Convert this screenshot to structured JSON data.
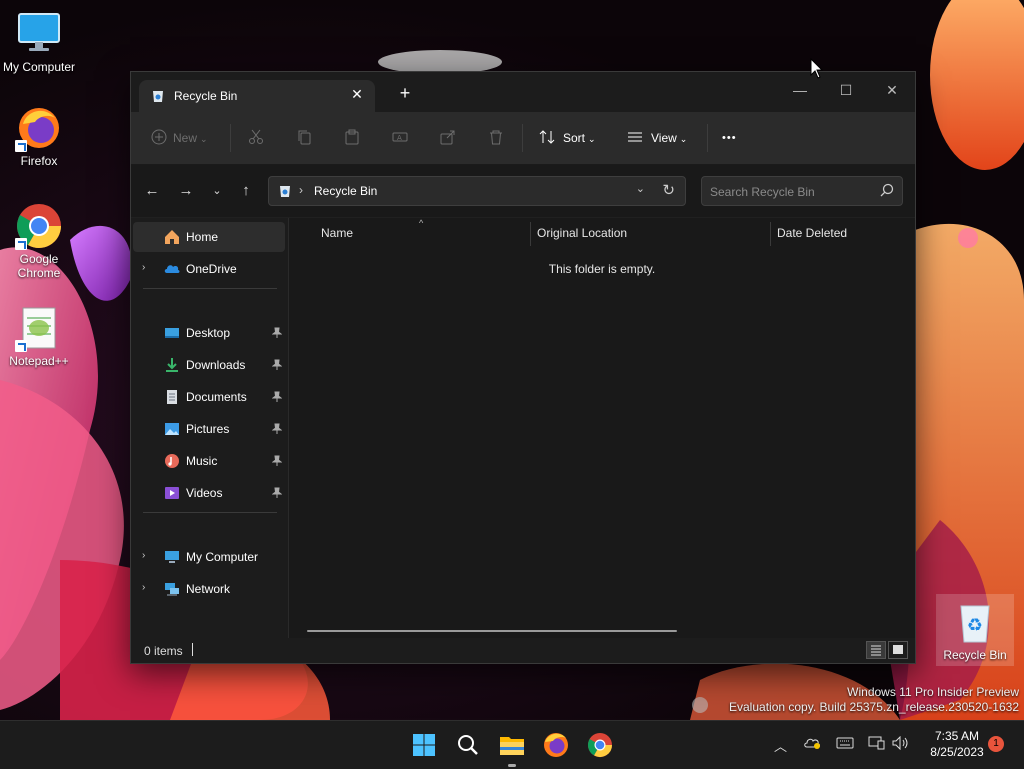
{
  "desktop": {
    "icons": [
      {
        "label": "My Computer",
        "icon": "monitor-icon"
      },
      {
        "label": "Firefox",
        "icon": "firefox-icon"
      },
      {
        "label": "Google Chrome",
        "icon": "chrome-icon"
      },
      {
        "label": "Notepad++",
        "icon": "notepadpp-icon"
      },
      {
        "label": "Recycle Bin",
        "icon": "recycle-bin-icon"
      }
    ],
    "watermark": {
      "line1": "Windows 11 Pro Insider Preview",
      "line2": "Evaluation copy. Build 25375.zn_release.230520-1632"
    }
  },
  "window": {
    "tab": {
      "label": "Recycle Bin",
      "icon": "recycle-bin-icon"
    },
    "new_tab_label": "+",
    "controls": {
      "minimize": "—",
      "maximize": "☐",
      "close": "✕"
    },
    "commands": {
      "new_label": "New",
      "sort_label": "Sort",
      "view_label": "View",
      "more_label": "•••"
    },
    "address": {
      "crumb": "Recycle Bin",
      "separator": "›"
    },
    "search": {
      "placeholder": "Search Recycle Bin",
      "value": ""
    },
    "sidebar": {
      "home": "Home",
      "onedrive": "OneDrive",
      "quick_access": [
        "Desktop",
        "Downloads",
        "Documents",
        "Pictures",
        "Music",
        "Videos"
      ],
      "my_computer": "My Computer",
      "network": "Network"
    },
    "columns": [
      "Name",
      "Original Location",
      "Date Deleted"
    ],
    "empty_message": "This folder is empty.",
    "status": {
      "items": "0 items"
    }
  },
  "taskbar": {
    "apps": [
      "start-icon",
      "search-icon",
      "file-explorer-icon",
      "firefox-icon",
      "chrome-icon"
    ],
    "clock": {
      "time": "7:35 AM",
      "date": "8/25/2023"
    },
    "notification_count": "1"
  }
}
